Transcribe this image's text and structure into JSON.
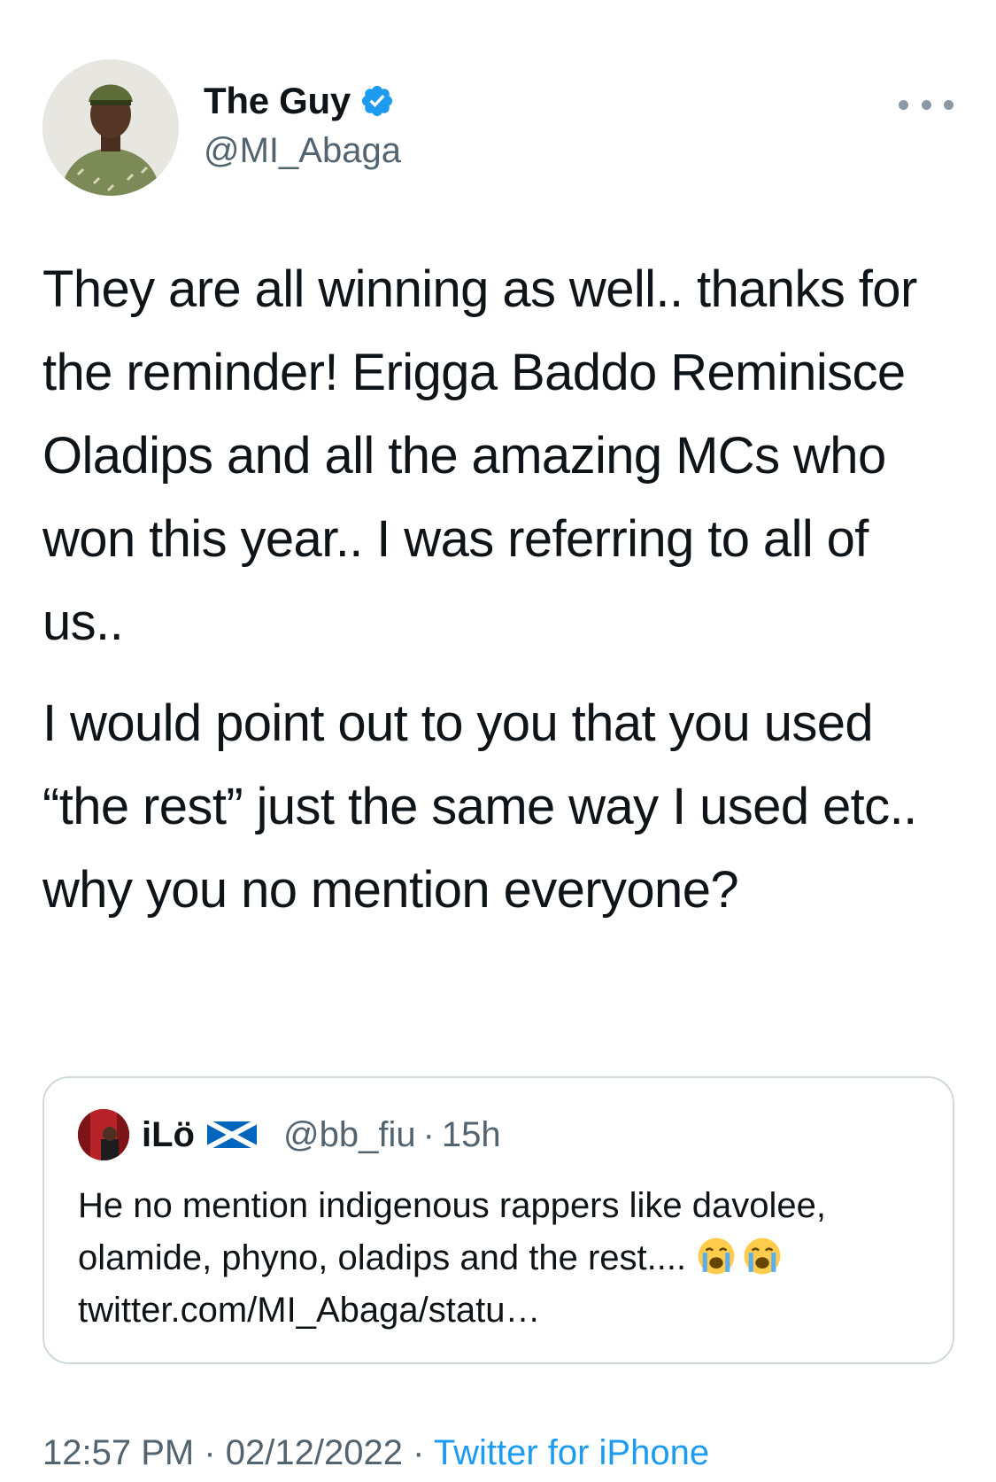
{
  "author": {
    "name": "The Guy",
    "handle": "@MI_Abaga",
    "verified": true
  },
  "tweet": {
    "paragraphs": [
      "They are all winning as well.. thanks for the reminder! Erigga Baddo Reminisce Oladips and all the amazing MCs who won this year.. I was referring to all of us..",
      "I would point out to you that you used “the rest” just the same way I used etc.. why you no mention everyone?"
    ]
  },
  "quoted_tweet": {
    "name": "iLö",
    "handle": "@bb_fiu",
    "separator": "·",
    "time": "15h",
    "text_before": "He no mention indigenous rappers like davolee, olamide, phyno, oladips and the rest....",
    "emojis": [
      "loudly-crying-face",
      "loudly-crying-face"
    ],
    "link": "twitter.com/MI_Abaga/statu…"
  },
  "footer": {
    "time": "12:57 PM",
    "separator": "·",
    "date": "02/12/2022",
    "source": "Twitter for iPhone"
  },
  "colors": {
    "text": "#0f1419",
    "secondary": "#536471",
    "link": "#1d9bf0",
    "verified": "#1d9bf0",
    "border": "#cfd9de"
  },
  "icons": {
    "verified": "verified-badge-icon",
    "more": "more-options-icon",
    "flag": "scotland-flag-icon"
  }
}
